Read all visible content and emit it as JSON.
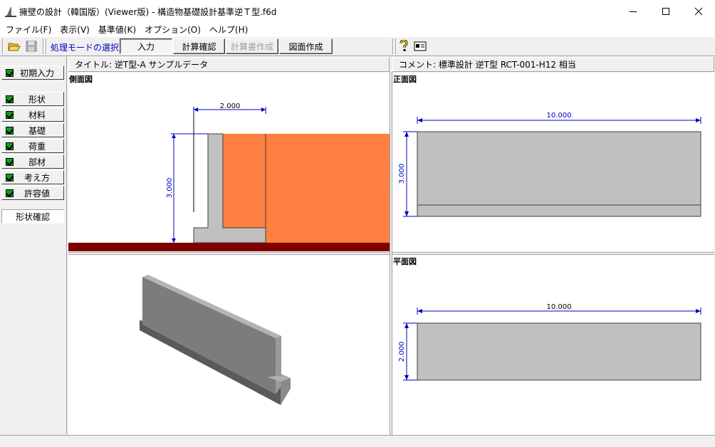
{
  "window": {
    "title": "擁壁の設計（韓国版）(Viewer版) - 構造物基礎設計基準逆Ｔ型.f6d"
  },
  "menu": {
    "items": [
      "ファイル(F)",
      "表示(V)",
      "基準値(K)",
      "オプション(O)",
      "ヘルプ(H)"
    ]
  },
  "toolbar": {
    "mode_label": "処理モードの選択",
    "mode_input": "入力",
    "mode_calc_check": "計算確認",
    "mode_report": "計算書作成",
    "mode_drawing": "図面作成"
  },
  "sidebar": {
    "initial_input": "初期入力",
    "items": [
      "形状",
      "材料",
      "基礎",
      "荷重",
      "部材",
      "考え方",
      "許容値"
    ],
    "shape_check": "形状確認"
  },
  "info": {
    "title_text": "タイトル: 逆T型-A サンプルデータ",
    "comment_text": "コメント: 標準設計  逆T型  RCT-001-H12 相当"
  },
  "views": {
    "side_label": "側面図",
    "front_label": "正面図",
    "plan_label": "平面図",
    "side_dim_width": "2.000",
    "side_dim_height": "3.000",
    "front_dim_width": "10.000",
    "front_dim_height": "3.000",
    "plan_dim_width": "10.000",
    "plan_dim_depth": "2.000"
  },
  "colors": {
    "soil": "#ff8040",
    "ground": "#800000",
    "concrete": "#c0c0c0",
    "dimension": "#0000c0",
    "check": "#1a9a1a"
  }
}
